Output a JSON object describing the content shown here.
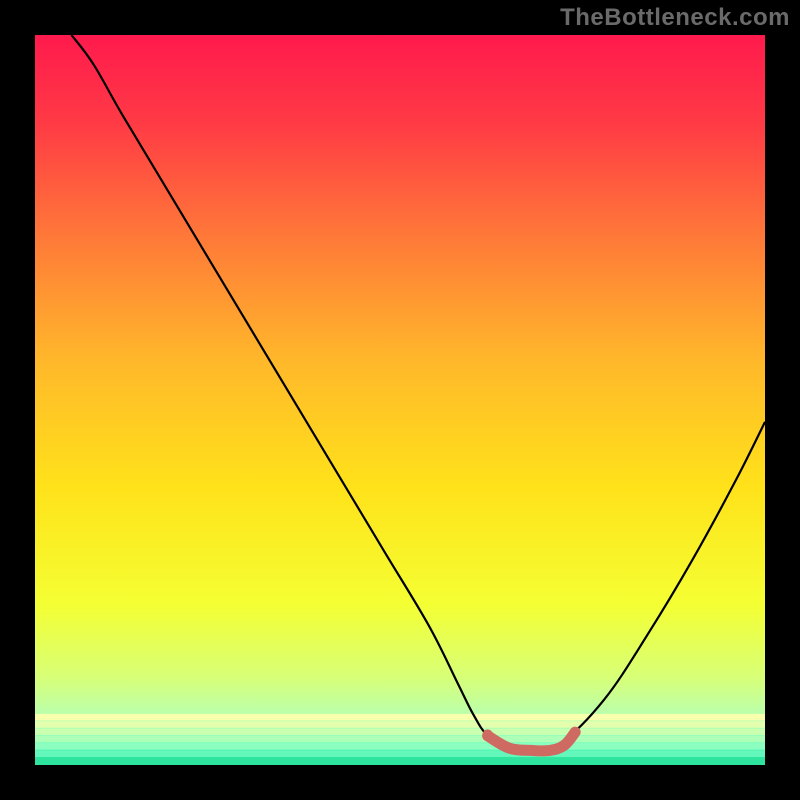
{
  "watermark": "TheBottleneck.com",
  "colors": {
    "curve": "#000000",
    "highlight": "#cf6a63",
    "marker": "#cf6a63"
  },
  "chart_data": {
    "type": "line",
    "title": "",
    "xlabel": "",
    "ylabel": "",
    "xlim": [
      0,
      100
    ],
    "ylim": [
      0,
      100
    ],
    "x": [
      5,
      8,
      12,
      18,
      24,
      30,
      36,
      42,
      48,
      54,
      58,
      60,
      62,
      65,
      68,
      72,
      78,
      84,
      90,
      96,
      100
    ],
    "values": [
      100,
      96,
      89,
      79,
      69,
      59,
      49,
      39,
      29,
      19,
      11,
      7,
      4,
      2,
      2,
      3,
      9,
      18,
      28,
      39,
      47
    ],
    "highlight_segment": {
      "x": [
        62,
        65,
        68,
        70.5,
        72.5,
        74
      ],
      "values": [
        4.0,
        2.3,
        2.0,
        2.0,
        2.7,
        4.5
      ]
    },
    "marker": {
      "x": 62,
      "y": 4.2
    },
    "gradient_stops": [
      {
        "offset": 0.0,
        "color": "#ff1a4d"
      },
      {
        "offset": 0.12,
        "color": "#ff3a45"
      },
      {
        "offset": 0.28,
        "color": "#ff7a38"
      },
      {
        "offset": 0.45,
        "color": "#ffb92a"
      },
      {
        "offset": 0.62,
        "color": "#ffe21a"
      },
      {
        "offset": 0.78,
        "color": "#f4ff33"
      },
      {
        "offset": 0.88,
        "color": "#d7ff77"
      },
      {
        "offset": 0.935,
        "color": "#b8ffb0"
      },
      {
        "offset": 0.965,
        "color": "#7effc0"
      },
      {
        "offset": 0.985,
        "color": "#36f0a8"
      },
      {
        "offset": 1.0,
        "color": "#14d88a"
      }
    ],
    "bottom_stripes": [
      {
        "y": 93.0,
        "h": 0.9,
        "color": "#f8ffad"
      },
      {
        "y": 94.0,
        "h": 0.9,
        "color": "#e3ffad"
      },
      {
        "y": 95.0,
        "h": 0.9,
        "color": "#caffb0"
      },
      {
        "y": 96.0,
        "h": 0.9,
        "color": "#adffb8"
      },
      {
        "y": 97.0,
        "h": 0.9,
        "color": "#8cffc0"
      },
      {
        "y": 98.0,
        "h": 0.9,
        "color": "#63f7bb"
      },
      {
        "y": 99.0,
        "h": 1.0,
        "color": "#2de39d"
      }
    ],
    "highlight_stroke_width": 11,
    "marker_radius": 5
  }
}
